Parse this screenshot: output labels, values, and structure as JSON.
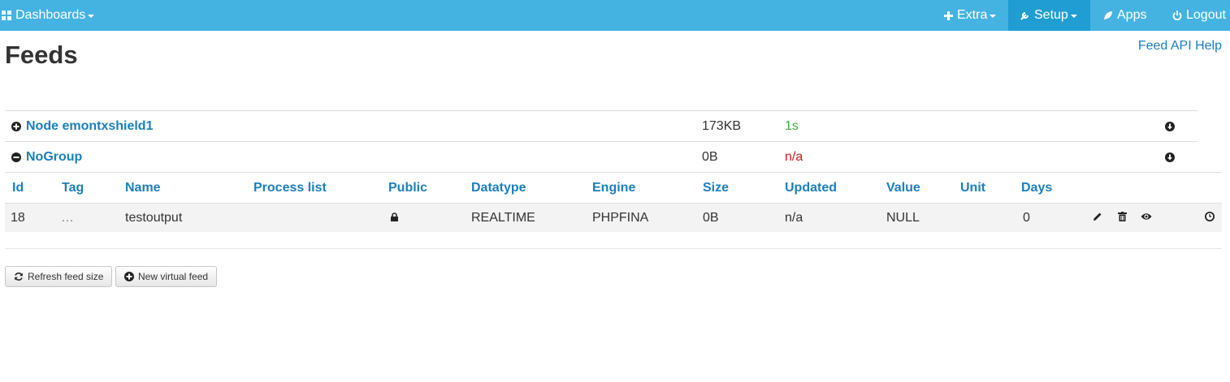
{
  "nav": {
    "dashboards": "Dashboards",
    "extra": "Extra",
    "setup": "Setup",
    "apps": "Apps",
    "logout": "Logout",
    "bar_color": "#44b3e2",
    "active_color": "#209ed3"
  },
  "page": {
    "title": "Feeds",
    "help_link": "Feed API Help"
  },
  "groups": [
    {
      "name": "Node emontxshield1",
      "size": "173KB",
      "updated": "1s",
      "updated_color": "#45a845",
      "toggle_icon": "plus-circle-icon"
    },
    {
      "name": "NoGroup",
      "size": "0B",
      "updated": "n/a",
      "updated_color": "#d01b1b",
      "toggle_icon": "minus-circle-icon"
    }
  ],
  "table": {
    "headers": {
      "id": "Id",
      "tag": "Tag",
      "name": "Name",
      "process_list": "Process list",
      "public": "Public",
      "datatype": "Datatype",
      "engine": "Engine",
      "size": "Size",
      "updated": "Updated",
      "value": "Value",
      "unit": "Unit",
      "days": "Days"
    },
    "rows": [
      {
        "id": "18",
        "tag": "…",
        "name": "testoutput",
        "process_list": "",
        "public_icon": "lock-icon",
        "datatype": "REALTIME",
        "engine": "PHPFINA",
        "size": "0B",
        "updated": "n/a",
        "value": "NULL",
        "unit": "",
        "days": "0"
      }
    ]
  },
  "buttons": {
    "refresh": "Refresh feed size",
    "new_virtual": "New virtual feed"
  }
}
